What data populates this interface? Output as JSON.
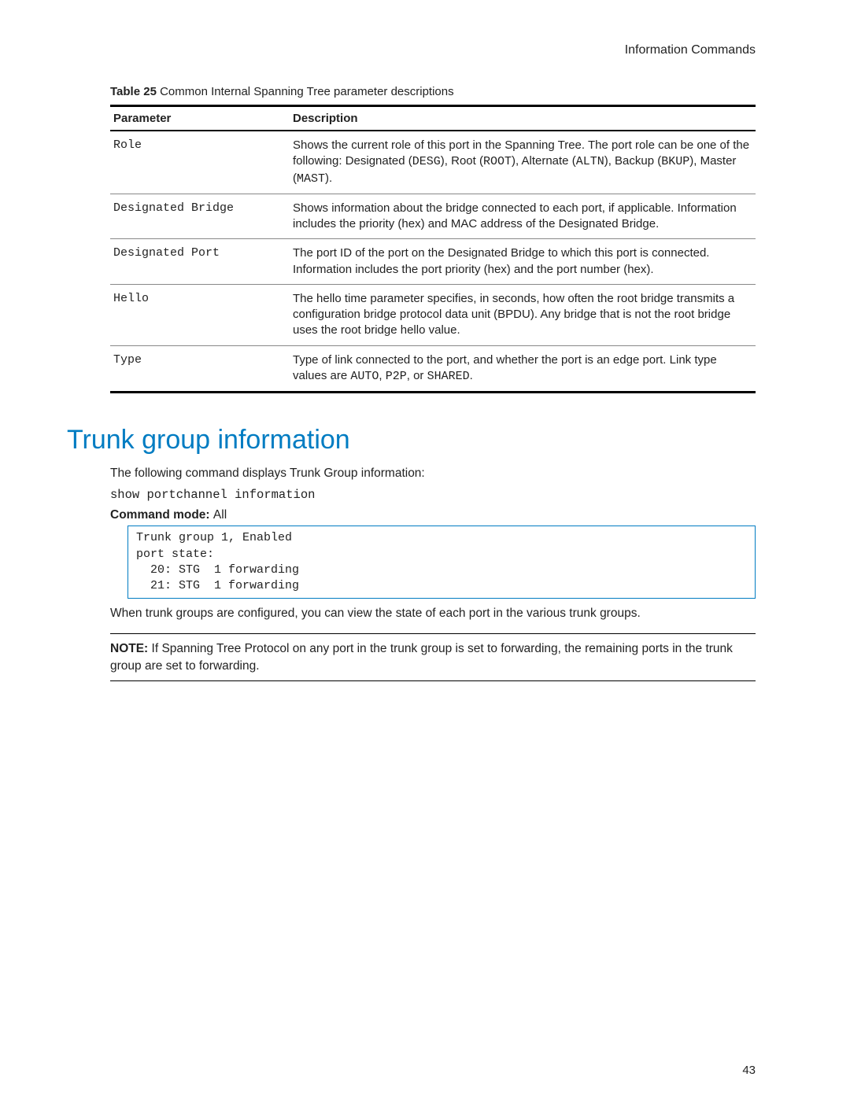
{
  "header": "Information Commands",
  "table_caption_bold": "Table 25",
  "table_caption_rest": "  Common Internal Spanning Tree parameter descriptions",
  "columns": {
    "param": "Parameter",
    "desc": "Description"
  },
  "rows": [
    {
      "param": "Role",
      "desc_parts": [
        "Shows the current role of this port in the Spanning Tree. The port role can be one of the following: Designated (",
        "DESG",
        "), Root (",
        "ROOT",
        "), Alternate (",
        "ALTN",
        "), Backup (",
        "BKUP",
        "), Master (",
        "MAST",
        ")."
      ]
    },
    {
      "param": "Designated Bridge",
      "desc_parts": [
        "Shows information about the bridge connected to each port, if applicable. Information includes the priority (hex) and MAC address of the Designated Bridge."
      ]
    },
    {
      "param": "Designated Port",
      "desc_parts": [
        "The port ID of the port on the Designated Bridge to which this port is connected. Information includes the port priority (hex) and the port number (hex)."
      ]
    },
    {
      "param": "Hello",
      "desc_parts": [
        "The hello time parameter specifies, in seconds, how often the root bridge transmits a configuration bridge protocol data unit (BPDU). Any bridge that is not the root bridge uses the root bridge hello value."
      ]
    },
    {
      "param": "Type",
      "desc_parts": [
        "Type of link connected to the port, and whether the port is an edge port. Link type values are ",
        "AUTO",
        ", ",
        "P2P",
        ", or ",
        "SHARED",
        "."
      ]
    }
  ],
  "section_heading": "Trunk group information",
  "intro_text": "The following command displays Trunk Group information:",
  "command_text": "show portchannel information",
  "command_mode_label": "Command mode: ",
  "command_mode_value": "All",
  "code_block": "Trunk group 1, Enabled\nport state:\n  20: STG  1 forwarding\n  21: STG  1 forwarding",
  "after_code_text": "When trunk groups are configured, you can view the state of each port in the various trunk groups.",
  "note_label": "NOTE:",
  "note_text": " If Spanning Tree Protocol on any port in the trunk group is set to forwarding, the remaining ports in the trunk group are set to forwarding.",
  "page_number": "43"
}
